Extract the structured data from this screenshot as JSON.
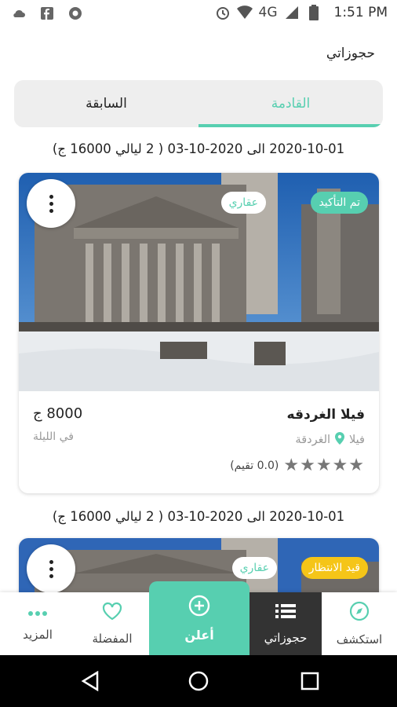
{
  "status_bar": {
    "time": "1:51 PM",
    "network": "4G",
    "icons": [
      "cloud-icon",
      "facebook-icon",
      "camera-aperture-icon",
      "alarm-icon",
      "wifi-icon",
      "signal-icon",
      "battery-icon"
    ]
  },
  "header": {
    "title": "حجوزاتي"
  },
  "tabs": [
    {
      "label": "القادمة",
      "active": true
    },
    {
      "label": "السابقة",
      "active": false
    }
  ],
  "bookings": [
    {
      "date_range": "2020-10-01 الى 2020-10-03 ( 2 ليالي 16000 ج)",
      "status": "تم التأكيد",
      "type_badge": "عقاري",
      "title": "فيلا الغردقه",
      "category": "فيلا",
      "location": "الغردقة",
      "price": "8000 ج",
      "price_unit": "في الليلة",
      "rating_text": "(0.0 تقيم)",
      "rating": 0
    },
    {
      "date_range": "2020-10-01 الى 2020-10-03 ( 2 ليالي 16000 ج)",
      "status": "قيد الانتظار",
      "type_badge": "عقاري"
    }
  ],
  "bottom_nav": {
    "explore": {
      "label": "استكشف",
      "icon": "compass-icon"
    },
    "bookings": {
      "label": "حجوزاتي",
      "icon": "list-icon"
    },
    "advertise": {
      "label": "أعلن",
      "icon": "add-circle-icon"
    },
    "favorites": {
      "label": "المفضلة",
      "icon": "heart-icon"
    },
    "more": {
      "label": "المزيد",
      "icon": "more-dots-icon"
    }
  },
  "colors": {
    "accent": "#57cfb0",
    "pending": "#f5c518",
    "dark": "#333333"
  }
}
